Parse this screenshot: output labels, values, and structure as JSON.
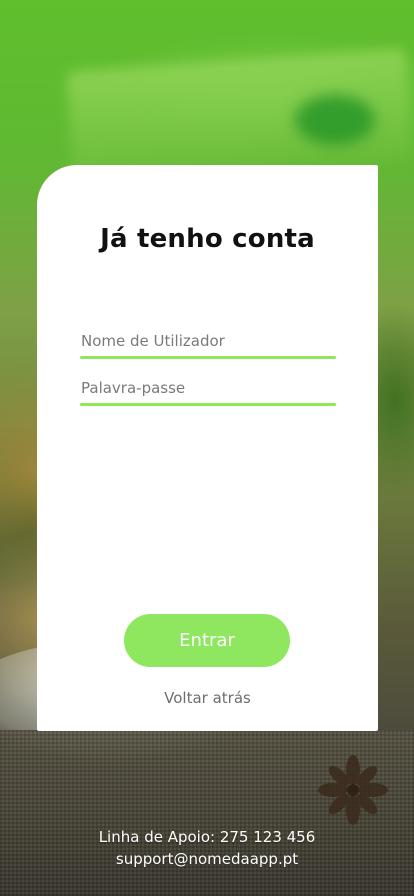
{
  "login": {
    "title": "Já tenho conta",
    "username_placeholder": "Nome de Utilizador",
    "username_value": "",
    "password_placeholder": "Palavra-passe",
    "password_value": "",
    "submit_label": "Entrar",
    "back_label": "Voltar atrás"
  },
  "footer": {
    "support_line": "Linha de Apoio: 275 123 456",
    "support_email": "support@nomedaapp.pt"
  },
  "colors": {
    "accent": "#8fe65f",
    "card": "#ffffff",
    "title": "#111111",
    "muted_text": "#6e6e6e"
  },
  "icons": {
    "background": "food-photo-background"
  }
}
